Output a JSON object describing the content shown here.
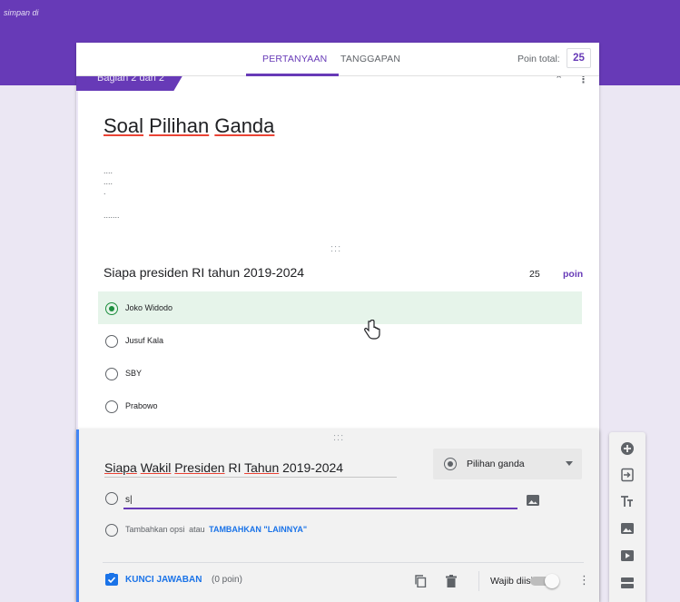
{
  "header": {
    "saved_note": "simpan di"
  },
  "tabs": [
    {
      "label": "PERTANYAAN"
    },
    {
      "label": "TANGGAPAN"
    }
  ],
  "points": {
    "label": "Poin total:",
    "value": "25"
  },
  "section": {
    "tag": "Bagian 2 dari 2"
  },
  "form": {
    "title_words": [
      "Soal",
      "Pilihan",
      "Ganda"
    ],
    "desc_lines": [
      "....",
      "....",
      ".",
      "......."
    ]
  },
  "question1": {
    "title": "Siapa presiden RI tahun 2019-2024",
    "points": "25",
    "points_unit": "poin",
    "options": [
      {
        "label": "Joko Widodo",
        "selected": true
      },
      {
        "label": "Jusuf Kala",
        "selected": false
      },
      {
        "label": "SBY",
        "selected": false
      },
      {
        "label": "Prabowo",
        "selected": false
      }
    ]
  },
  "question2": {
    "title_words": [
      "Siapa",
      "Wakil",
      "Presiden",
      "RI",
      "Tahun",
      "2019-2024"
    ],
    "type_label": "Pilihan ganda",
    "option_value": "s|",
    "add_option": "Tambahkan opsi",
    "or_text": "atau",
    "add_other": "TAMBAHKAN \"LAINNYA\"",
    "answer_key": "KUNCI JAWABAN",
    "answer_points": "(0 poin)",
    "required_label": "Wajib diisi"
  },
  "drag_handle": ":::",
  "icons": {
    "more": "vertical-dots-icon",
    "collapse": "chevron-up-icon",
    "toolbar": [
      "add-circle-icon",
      "import-icon",
      "title-icon",
      "image-icon",
      "video-icon",
      "section-icon"
    ]
  },
  "colors": {
    "primary": "#673ab7",
    "selected_option_bg": "#e6f4ea",
    "correct_green": "#1e8e3e",
    "link_blue": "#1a73e8",
    "active_border": "#4285f4"
  }
}
